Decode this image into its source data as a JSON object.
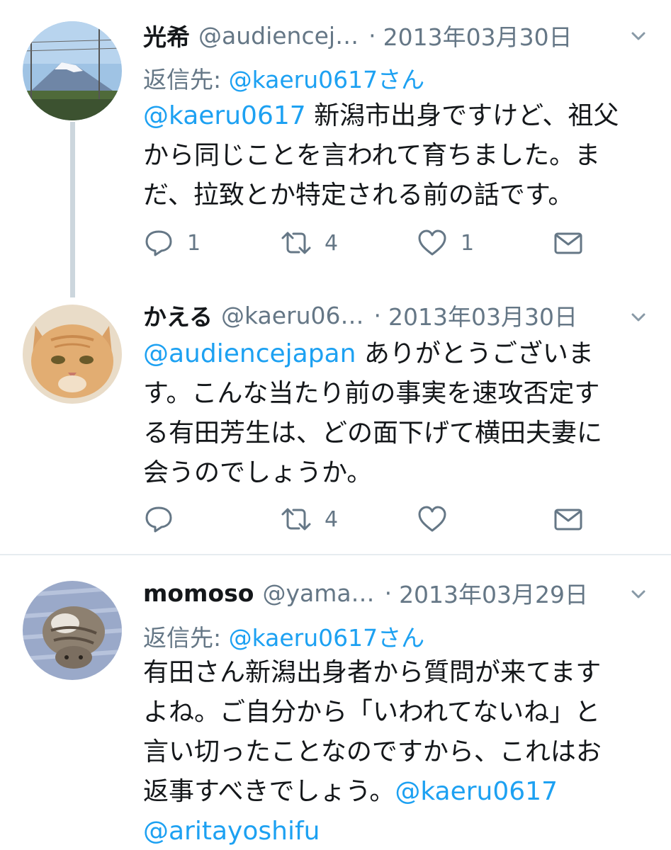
{
  "tweets": [
    {
      "name": "光希",
      "handle": "@audiencej…",
      "date": "2013年03月30日",
      "reply_to_label": "返信先:",
      "reply_to_user": "@kaeru0617さん",
      "text_lines": [
        [
          {
            "link": "@kaeru0617"
          },
          {
            "text": " 新潟市出身ですけど、祖父"
          }
        ],
        [
          {
            "text": "から同じことを言われて育ちました。ま"
          }
        ],
        [
          {
            "text": "だ、拉致とか特定される前の話です。"
          }
        ]
      ],
      "reply_count": "1",
      "retweet_count": "4",
      "like_count": "1",
      "avatar_icon": "mount-fuji-photo"
    },
    {
      "name": "かえる",
      "handle": "@kaeru06…",
      "date": "2013年03月30日",
      "text_lines": [
        [
          {
            "link": "@audiencejapan"
          },
          {
            "text": " ありがとうございま"
          }
        ],
        [
          {
            "text": "す。こんな当たり前の事実を速攻否定す"
          }
        ],
        [
          {
            "text": "る有田芳生は、どの面下げて横田夫妻に"
          }
        ],
        [
          {
            "text": "会うのでしょうか。"
          }
        ]
      ],
      "reply_count": "",
      "retweet_count": "4",
      "like_count": "",
      "avatar_icon": "orange-cat-photo"
    },
    {
      "name": "momoso",
      "handle": "@yama…",
      "date": "2013年03月29日",
      "reply_to_label": "返信先:",
      "reply_to_user": "@kaeru0617さん",
      "text_lines": [
        [
          {
            "text": "有田さん新潟出身者から質問が来てます"
          }
        ],
        [
          {
            "text": "よね。ご自分から「いわれてないね」と"
          }
        ],
        [
          {
            "text": "言い切ったことなのですから、これはお"
          }
        ],
        [
          {
            "text": "返事すべきでしょう。"
          },
          {
            "link": "@kaeru0617"
          }
        ],
        [
          {
            "link": "@aritayoshifu"
          }
        ]
      ],
      "avatar_icon": "tabby-cat-photo"
    }
  ],
  "icons": {
    "reply": "reply-icon",
    "retweet": "retweet-icon",
    "like": "heart-icon",
    "dm": "envelope-icon",
    "chevron": "chevron-down-icon"
  },
  "colors": {
    "link": "#1da1f2",
    "secondary": "#657786",
    "thread_line": "#ccd6dd"
  }
}
